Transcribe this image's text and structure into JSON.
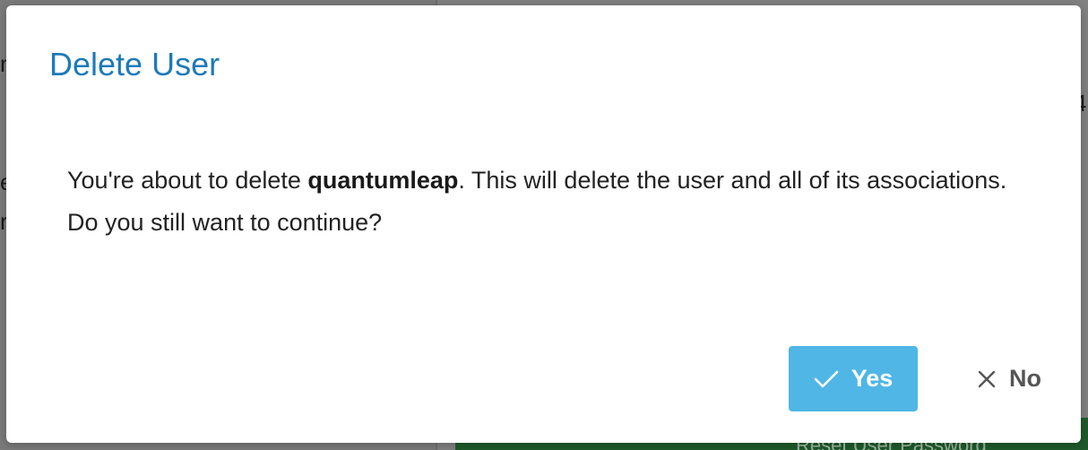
{
  "background": {
    "left_glyphs": [
      "r",
      "e",
      "r"
    ],
    "right_glyph": "4",
    "footer_button_label": "Reset User Password"
  },
  "dialog": {
    "title": "Delete User",
    "message_prefix": "You're about to delete ",
    "target_name": "quantumleap",
    "message_suffix": ". This will delete the user and all of its associations. Do you still want to continue?",
    "confirm_label": "Yes",
    "confirm_icon": "check-icon",
    "cancel_label": "No",
    "cancel_icon": "close-icon"
  },
  "colors": {
    "title": "#1d7ab8",
    "confirm_bg": "#4fb6e6",
    "overlay": "#7d7d7d",
    "footer_bar": "#1f5a2b"
  }
}
